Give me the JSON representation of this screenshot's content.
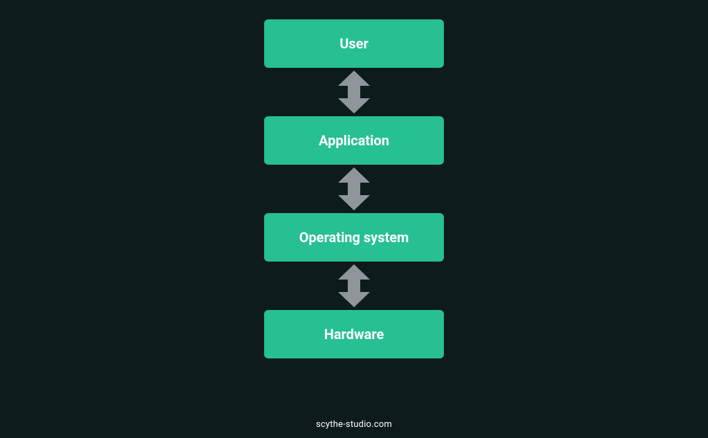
{
  "layers": [
    {
      "label": "User"
    },
    {
      "label": "Application"
    },
    {
      "label": "Operating system"
    },
    {
      "label": "Hardware"
    }
  ],
  "footer": "scythe-studio.com",
  "colors": {
    "background": "#0d1b1c",
    "box": "#27c093",
    "arrow": "#8f969b",
    "text": "#ffffff"
  }
}
